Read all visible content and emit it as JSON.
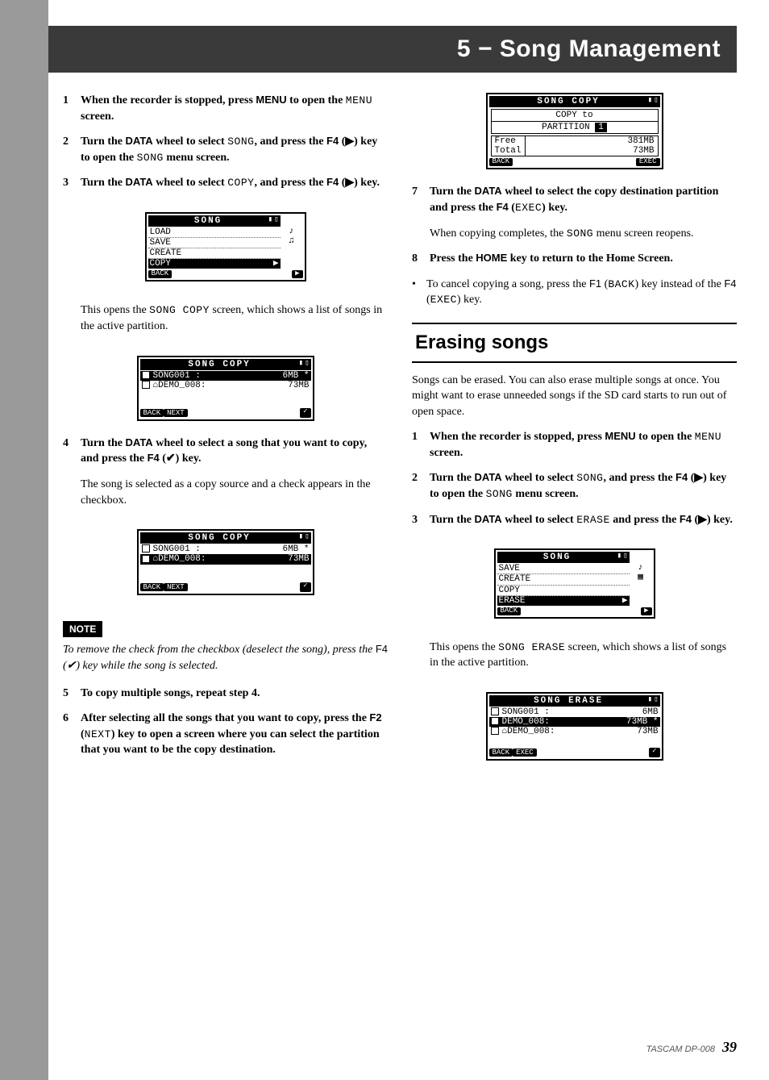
{
  "header": {
    "title": "5 − Song Management"
  },
  "col_left": {
    "step1": {
      "num": "1",
      "text_a": "When the recorder is stopped, press ",
      "key_menu": "MENU",
      "text_b": " to open the ",
      "mono_menu": "MENU",
      "text_c": " screen."
    },
    "step2": {
      "num": "2",
      "text_a": "Turn the ",
      "key_data": "DATA",
      "text_b": " wheel to select ",
      "mono_song": "SONG",
      "text_c": ", and press the ",
      "key_f4": "F4",
      "text_d": " (▶) key to open the ",
      "mono_song2": "SONG",
      "text_e": " menu screen."
    },
    "step3": {
      "num": "3",
      "text_a": "Turn the ",
      "key_data": "DATA",
      "text_b": " wheel to select ",
      "mono_copy": "COPY",
      "text_c": ", and press the ",
      "key_f4": "F4",
      "text_d": " (▶) key."
    },
    "screen1": {
      "title": "SONG",
      "rows": [
        "LOAD",
        "SAVE",
        "CREATE",
        "COPY"
      ],
      "back": "BACK",
      "play": "▶"
    },
    "para1": {
      "text_a": "This opens the ",
      "mono": "SONG COPY",
      "text_b": " screen, which shows a list of songs in the active partition."
    },
    "screen2": {
      "title": "SONG COPY",
      "row1_name": "SONG001 :",
      "row1_size": "6MB",
      "row1_star": "*",
      "row2_name": "⌂DEMO_008:",
      "row2_size": "73MB",
      "back": "BACK",
      "next": "NEXT",
      "check": "✓"
    },
    "step4": {
      "num": "4",
      "text_a": "Turn the ",
      "key_data": "DATA",
      "text_b": " wheel to select a song that you want to copy, and press the ",
      "key_f4": "F4",
      "text_c": " (✔) key."
    },
    "para2": "The song is selected as a copy source and a check appears in the checkbox.",
    "screen3": {
      "title": "SONG COPY",
      "row1_name": "SONG001 :",
      "row1_size": "6MB",
      "row1_star": "*",
      "row2_name": "⌂DEMO_008:",
      "row2_size": "73MB",
      "back": "BACK",
      "next": "NEXT",
      "check": "✓"
    },
    "note_label": "NOTE",
    "note_text": {
      "text_a": "To remove the check from the checkbox (deselect the song), press the ",
      "key_f4": "F4",
      "text_b": " (✔) key while the song is selected."
    },
    "step5": {
      "num": "5",
      "text": "To copy multiple songs, repeat step 4."
    },
    "step6": {
      "num": "6",
      "text_a": "After selecting all the songs that you want to copy, press the ",
      "key_f2": "F2",
      "text_b": " (",
      "mono_next": "NEXT",
      "text_c": ") key to open a screen where you can select the partition that you want to be the copy destination."
    }
  },
  "col_right": {
    "screen4": {
      "title": "SONG COPY",
      "copyto": "COPY to",
      "partition": "PARTITION",
      "partnum": "1",
      "free_label": "Free",
      "free_val": "381MB",
      "total_label": "Total",
      "total_val": "73MB",
      "back": "BACK",
      "exec": "EXEC"
    },
    "step7": {
      "num": "7",
      "text_a": "Turn the ",
      "key_data": "DATA",
      "text_b": " wheel to select the copy destination partition and press the ",
      "key_f4": "F4",
      "text_c": " (",
      "mono_exec": "EXEC",
      "text_d": ") key."
    },
    "para3": {
      "text_a": "When copying completes, the ",
      "mono": "SONG",
      "text_b": " menu screen reopens."
    },
    "step8": {
      "num": "8",
      "text_a": "Press the ",
      "key_home": "HOME",
      "text_b": " key to return to the Home Screen."
    },
    "bullet1": {
      "text_a": "To cancel copying a song, press the ",
      "key_f1": "F1",
      "text_b": " (",
      "mono_back": "BACK",
      "text_c": ") key instead of the ",
      "key_f4": "F4",
      "text_d": " (",
      "mono_exec": "EXEC",
      "text_e": ") key."
    },
    "heading": "Erasing songs",
    "intro": "Songs can be erased. You can also erase multiple songs at once. You might want to erase unneeded songs if the SD card starts to run out of open space.",
    "estep1": {
      "num": "1",
      "text_a": "When the recorder is stopped, press ",
      "key_menu": "MENU",
      "text_b": " to open the ",
      "mono_menu": "MENU",
      "text_c": " screen."
    },
    "estep2": {
      "num": "2",
      "text_a": " Turn the ",
      "key_data": "DATA",
      "text_b": " wheel to select ",
      "mono_song": "SONG",
      "text_c": ", and press the ",
      "key_f4": "F4",
      "text_d": " (▶) key to open the ",
      "mono_song2": "SONG",
      "text_e": " menu screen."
    },
    "estep3": {
      "num": "3",
      "text_a": "Turn the ",
      "key_data": "DATA",
      "text_b": " wheel to select ",
      "mono_erase": "ERASE",
      "text_c": " and press the ",
      "key_f4": "F4",
      "text_d": " (▶) key."
    },
    "screen5": {
      "title": "SONG",
      "rows": [
        "SAVE",
        "CREATE",
        "COPY",
        "ERASE"
      ],
      "back": "BACK",
      "play": "▶"
    },
    "para4": {
      "text_a": "This opens the ",
      "mono": "SONG ERASE",
      "text_b": " screen, which shows a list of songs in the active partition."
    },
    "screen6": {
      "title": "SONG ERASE",
      "row1_name": "SONG001 :",
      "row1_size": "6MB",
      "row2_name": "DEMO_008:",
      "row2_size": "73MB",
      "row2_star": "*",
      "row3_name": "⌂DEMO_008:",
      "row3_size": "73MB",
      "back": "BACK",
      "exec": "EXEC",
      "check": "✓"
    }
  },
  "footer": {
    "brand": "TASCAM DP-008",
    "page": "39"
  }
}
